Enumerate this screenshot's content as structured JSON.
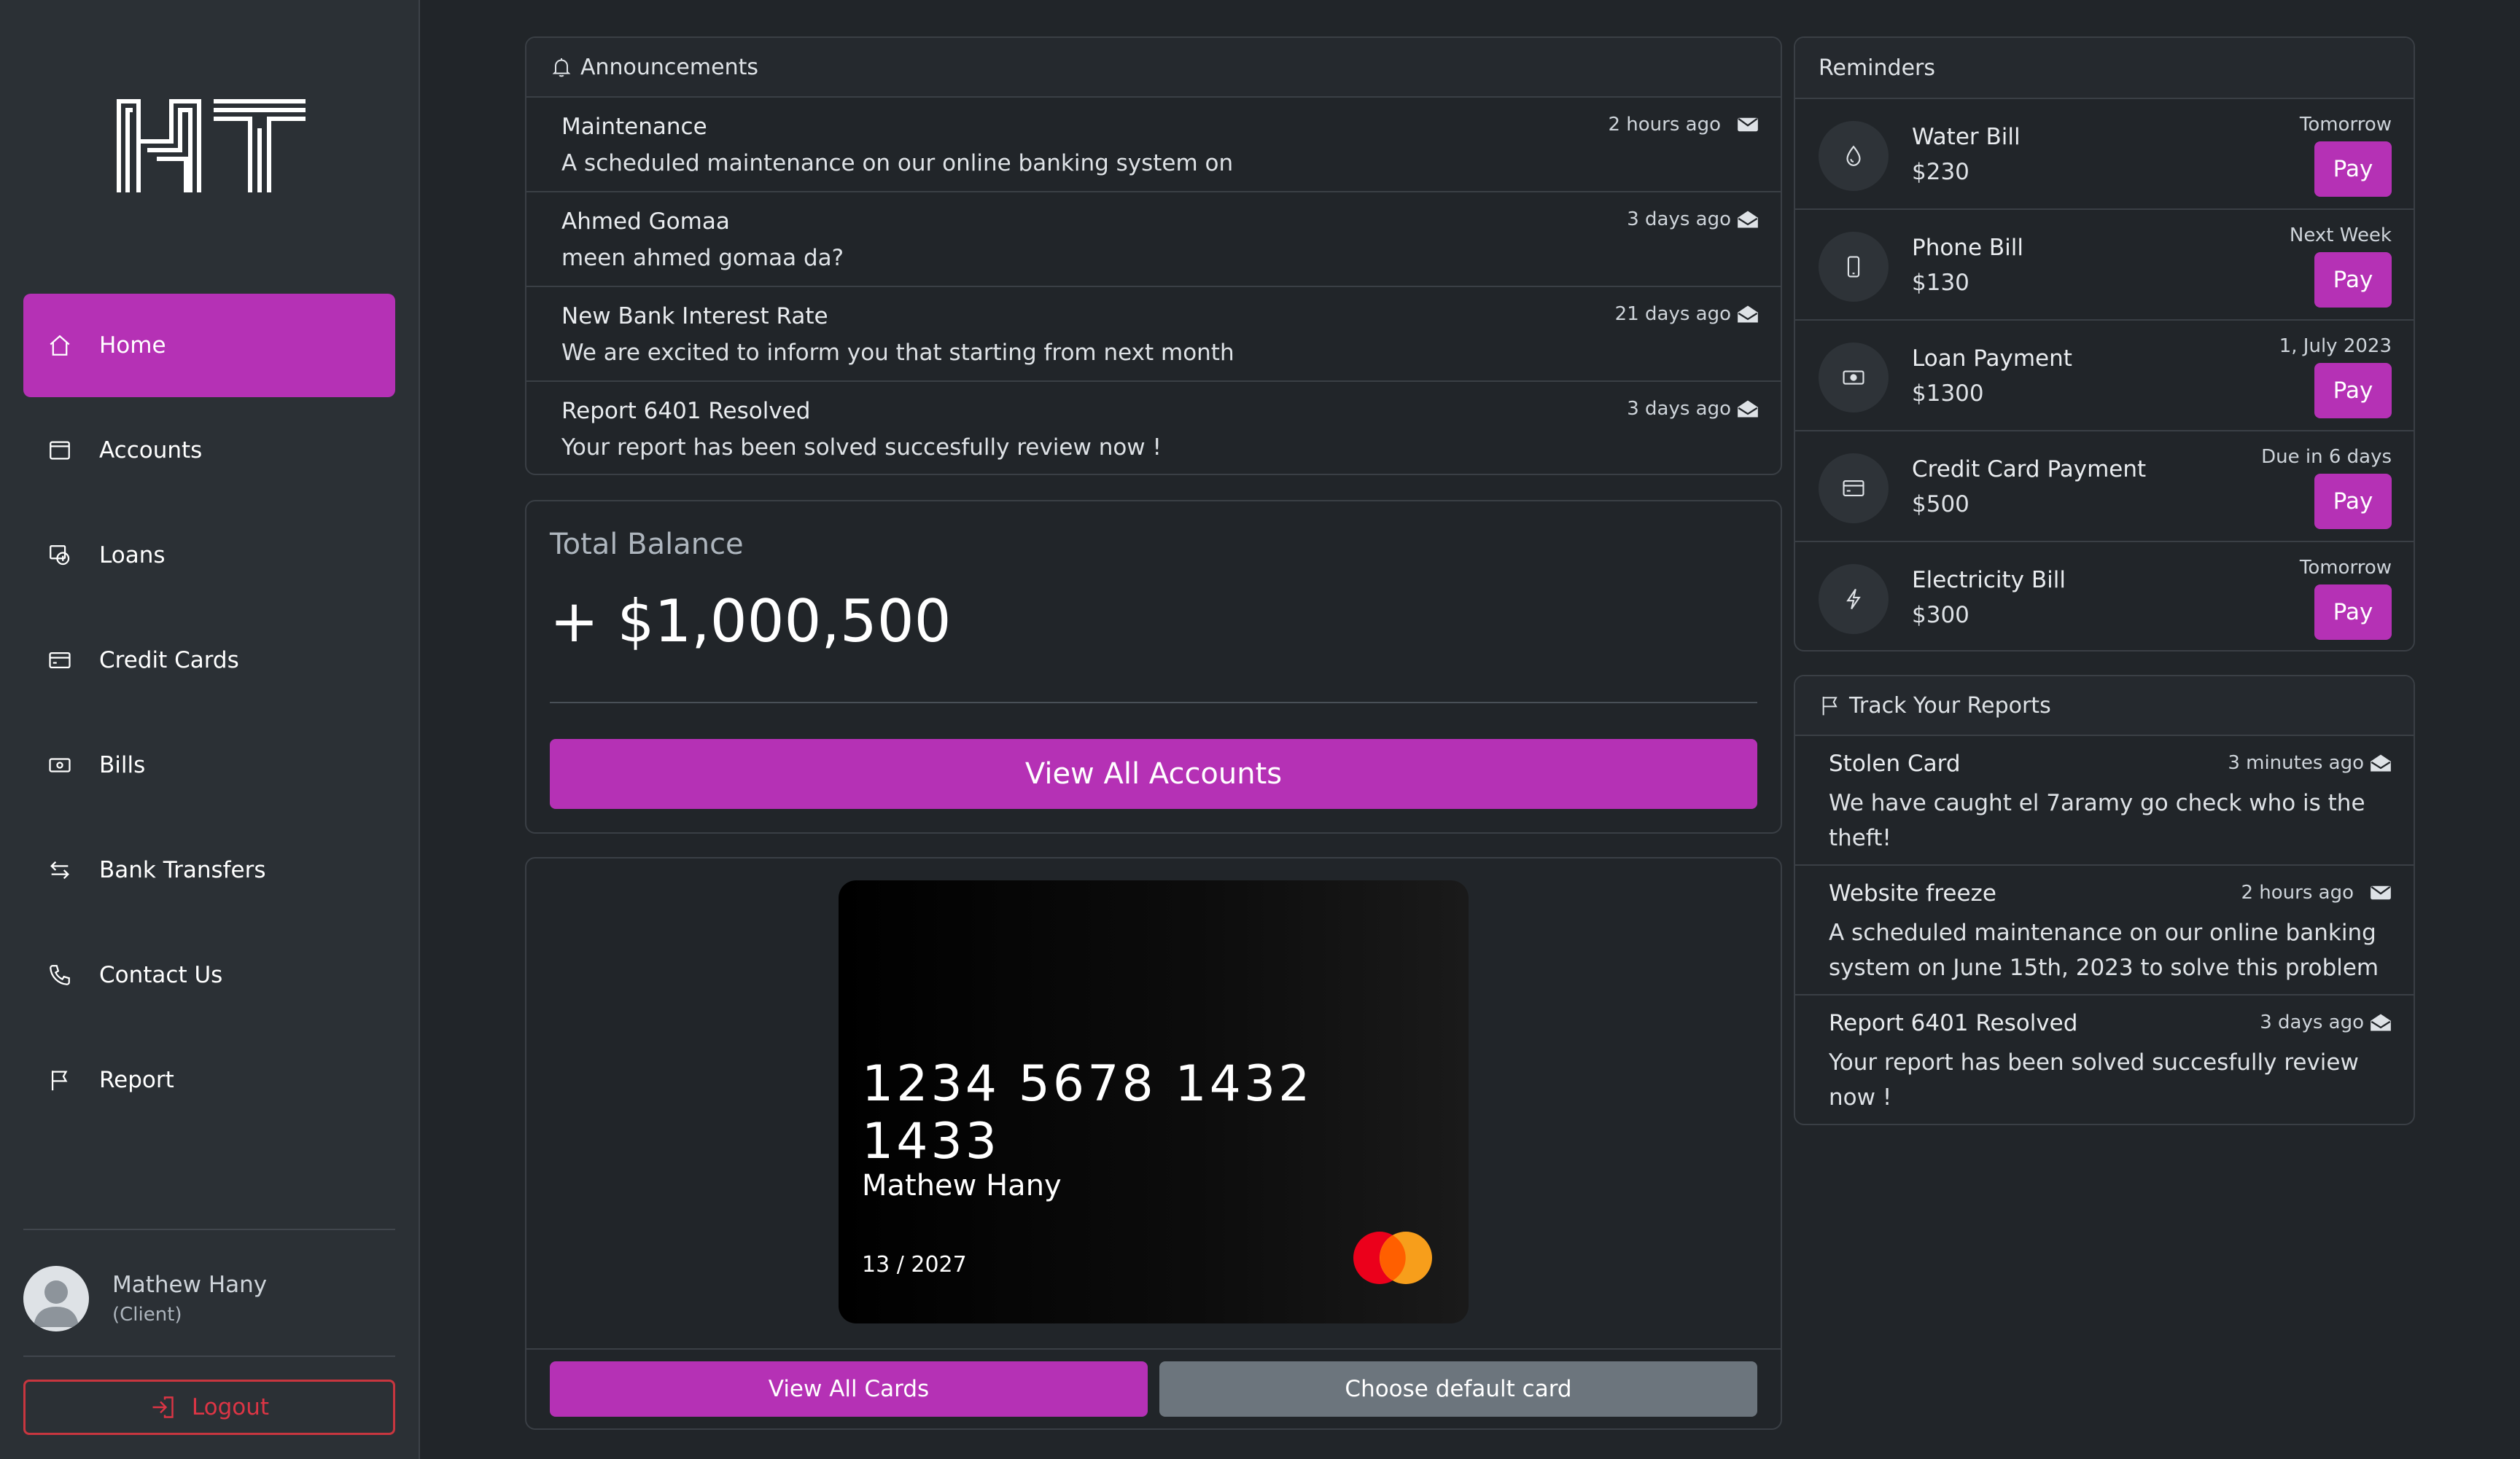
{
  "colors": {
    "accent": "#b531b5",
    "background": "#212529",
    "sidebar": "#2b3035",
    "danger": "#dc3545",
    "secondary": "#6c757d"
  },
  "sidebar": {
    "logo_text": "NT",
    "items": [
      {
        "label": "Home",
        "icon": "home-icon",
        "active": true
      },
      {
        "label": "Accounts",
        "icon": "wallet-icon"
      },
      {
        "label": "Loans",
        "icon": "loan-icon"
      },
      {
        "label": "Credit Cards",
        "icon": "credit-card-icon"
      },
      {
        "label": "Bills",
        "icon": "cash-icon"
      },
      {
        "label": "Bank Transfers",
        "icon": "transfer-arrows-icon"
      },
      {
        "label": "Contact Us",
        "icon": "phone-icon"
      },
      {
        "label": "Report",
        "icon": "flag-icon"
      }
    ],
    "user": {
      "name": "Mathew Hany",
      "role": "(Client)"
    },
    "logout_label": "Logout"
  },
  "announcements": {
    "title": "Announcements",
    "items": [
      {
        "title": "Maintenance",
        "body": "A scheduled maintenance on our online banking system on",
        "time": "2 hours ago",
        "icon": "envelope-icon"
      },
      {
        "title": "Ahmed Gomaa",
        "body": "meen ahmed gomaa da?",
        "time": "3 days ago",
        "icon": "envelope-open-icon"
      },
      {
        "title": "New Bank Interest Rate",
        "body": "We are excited to inform you that starting from next month",
        "time": "21 days ago",
        "icon": "envelope-open-icon"
      },
      {
        "title": "Report 6401 Resolved",
        "body": "Your report has been solved succesfully review now !",
        "time": "3 days ago",
        "icon": "envelope-open-icon"
      }
    ]
  },
  "balance": {
    "label": "Total Balance",
    "amount": "+ $1,000,500",
    "button": "View All Accounts"
  },
  "card": {
    "number": "1234 5678 1432 1433",
    "holder": "Mathew Hany",
    "expiry": "13 / 2027",
    "brand_icon": "mastercard-icon",
    "view_all": "View All Cards",
    "choose_default": "Choose default card"
  },
  "reminders": {
    "title": "Reminders",
    "pay_label": "Pay",
    "items": [
      {
        "title": "Water Bill",
        "amount": "$230",
        "when": "Tomorrow",
        "icon": "droplet-icon"
      },
      {
        "title": "Phone Bill",
        "amount": "$130",
        "when": "Next Week",
        "icon": "phone-device-icon"
      },
      {
        "title": "Loan Payment",
        "amount": "$1300",
        "when": "1, July 2023",
        "icon": "cash-icon"
      },
      {
        "title": "Credit Card Payment",
        "amount": "$500",
        "when": "Due in 6 days",
        "icon": "credit-card-icon"
      },
      {
        "title": "Electricity Bill",
        "amount": "$300",
        "when": "Tomorrow",
        "icon": "lightning-icon"
      }
    ]
  },
  "reports": {
    "title": "Track Your Reports",
    "items": [
      {
        "title": "Stolen Card",
        "body": "We have caught el 7aramy go check who is the theft!",
        "time": "3 minutes ago",
        "icon": "envelope-open-icon"
      },
      {
        "title": "Website freeze",
        "body": "A scheduled maintenance on our online banking system on June 15th, 2023 to solve this problem",
        "time": "2 hours ago",
        "icon": "envelope-icon"
      },
      {
        "title": "Report 6401 Resolved",
        "body": "Your report has been solved succesfully review now !",
        "time": "3 days ago",
        "icon": "envelope-open-icon"
      }
    ]
  }
}
